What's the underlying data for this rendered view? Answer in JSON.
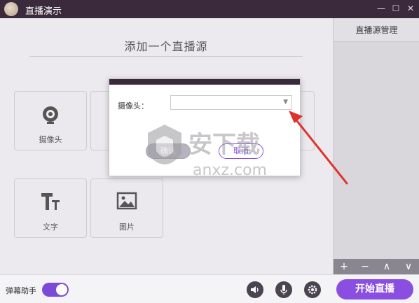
{
  "window": {
    "title": "直播演示"
  },
  "main": {
    "heading": "添加一个直播源",
    "tiles": [
      {
        "label": "摄像头",
        "icon": "webcam-icon"
      },
      {
        "label": "",
        "icon": ""
      },
      {
        "label": "",
        "icon": ""
      },
      {
        "label": "文字",
        "icon": "text-icon"
      },
      {
        "label": "图片",
        "icon": "image-icon"
      }
    ]
  },
  "sidebar": {
    "title": "直播源管理",
    "buttons": [
      "+",
      "−",
      "∧",
      "∨"
    ]
  },
  "bottom": {
    "danmu_label": "弹幕助手",
    "start_label": "开始直播"
  },
  "dialog": {
    "camera_label": "摄像头：",
    "select_value": "",
    "ok_label": "确认",
    "cancel_label": "取消"
  },
  "watermark": {
    "text": "安下载",
    "sub": "anxz.com"
  },
  "colors": {
    "accent": "#8a4fe0",
    "titlebar": "#3a2a3c",
    "annotation": "#e0322b"
  }
}
